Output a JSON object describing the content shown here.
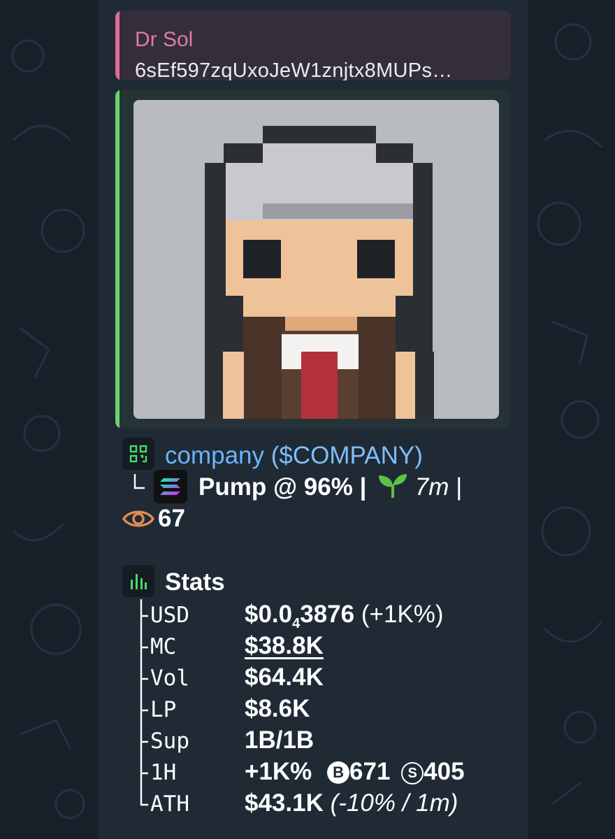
{
  "reply": {
    "author": "Dr Sol",
    "text": "6sEf597zqUxoJeW1znjtx8MUPs…"
  },
  "token": {
    "name": "company",
    "ticker": "($COMPANY)",
    "platform": "Pump @ 96% |",
    "age": "7m",
    "age_separator": "|",
    "views": "67",
    "bonding_progress_pct": 96
  },
  "stats": {
    "title": "Stats",
    "rows": {
      "usd": {
        "key": "USD",
        "value_main": "$0.0",
        "value_sub": "4",
        "value_rest": "3876",
        "change": " (+1K%)"
      },
      "mc": {
        "key": "MC",
        "value": "$38.8K"
      },
      "vol": {
        "key": "Vol",
        "value": "$64.4K"
      },
      "lp": {
        "key": "LP",
        "value": "$8.6K"
      },
      "sup": {
        "key": "Sup",
        "value": "1B/1B"
      },
      "h1": {
        "key": "1H",
        "change": "+1K%",
        "buys_icon": "B",
        "buys": "671",
        "sells_icon": "S",
        "sells": "405"
      },
      "ath": {
        "key": "ATH",
        "value": "$43.1K",
        "detail": " (-10% / 1m)"
      }
    }
  },
  "colors": {
    "background": "#172029",
    "bubble": "#1f2a35",
    "reply_accent": "#e06c97",
    "preview_accent": "#6bd36b",
    "link": "#69b4ff",
    "seedling": "#5cc24a",
    "eye": "#e08a52",
    "stats_icon": "#4cd964"
  },
  "icons": {
    "token_icon": "qr-code-icon",
    "platform_icon": "solana-icon",
    "age_icon": "seedling-icon",
    "views_icon": "eye-icon",
    "stats_icon": "bar-chart-icon"
  },
  "image": {
    "subject": "pixel-art-character"
  }
}
